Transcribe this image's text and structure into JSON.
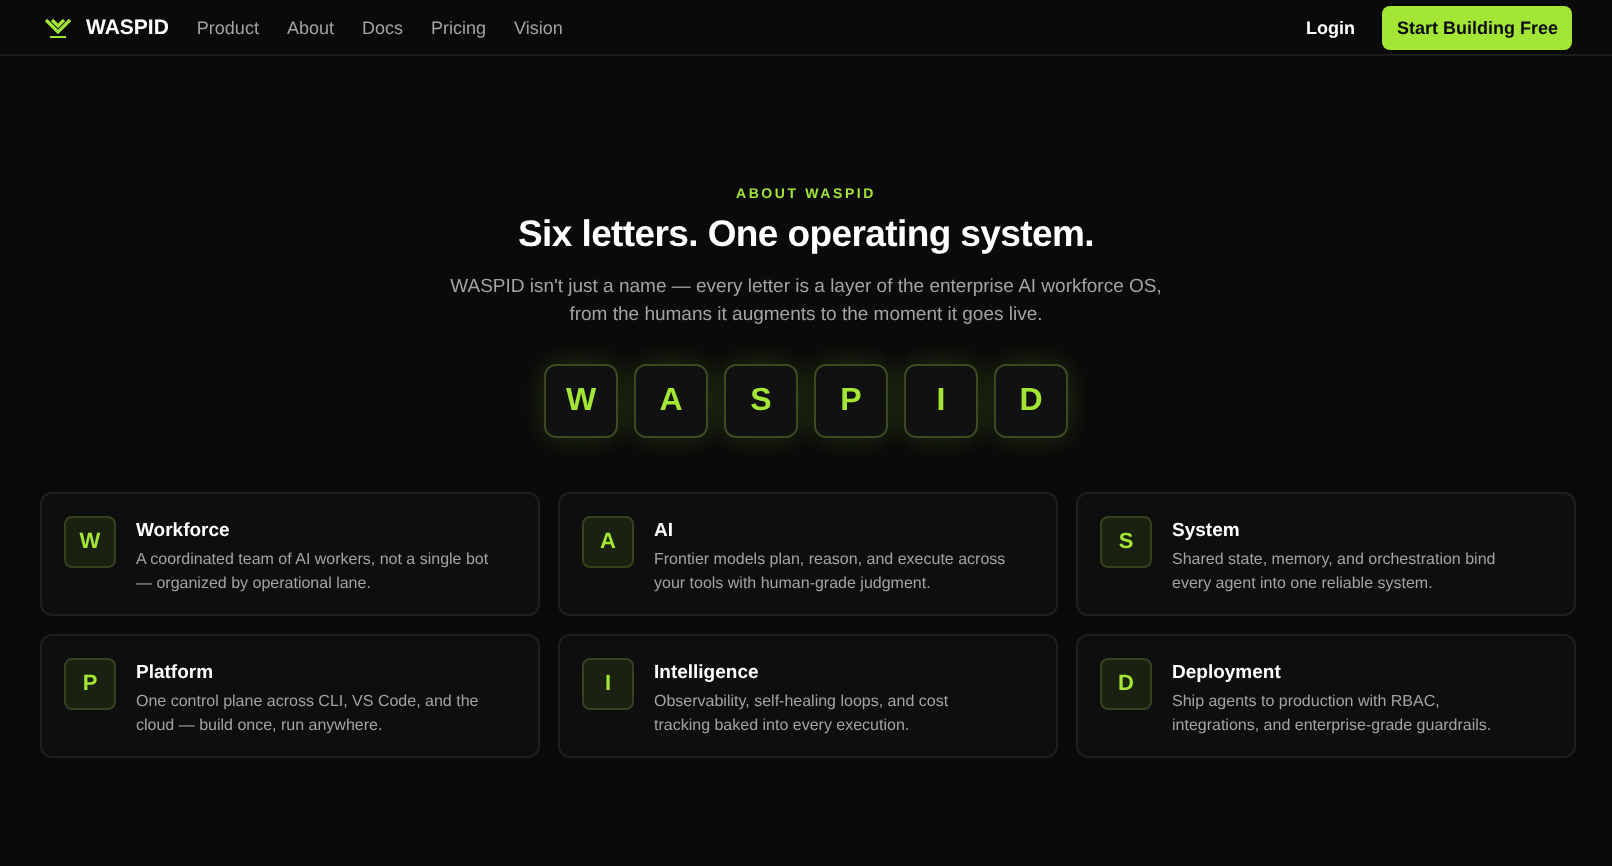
{
  "nav": {
    "brand": "WASPID",
    "links": [
      "Product",
      "About",
      "Docs",
      "Pricing",
      "Vision"
    ],
    "login": "Login",
    "cta": "Start Building Free"
  },
  "hero": {
    "eyebrow": "ABOUT WASPID",
    "title": "Six letters. One operating system.",
    "subtitle": [
      "WASPID isn't just a name — every letter is a layer of the enterprise AI workforce OS,",
      "from the humans it augments to the moment it goes live."
    ],
    "letters": [
      "W",
      "A",
      "S",
      "P",
      "I",
      "D"
    ]
  },
  "cards": [
    {
      "letter": "W",
      "title": "Workforce",
      "text": [
        "A coordinated team of AI workers, not a single bot",
        "— organized by operational lane."
      ]
    },
    {
      "letter": "A",
      "title": "AI",
      "text": [
        "Frontier models plan, reason, and execute across",
        "your tools with human-grade judgment."
      ]
    },
    {
      "letter": "S",
      "title": "System",
      "text": [
        "Shared state, memory, and orchestration bind",
        "every agent into one reliable system."
      ]
    },
    {
      "letter": "P",
      "title": "Platform",
      "text": [
        "One control plane across CLI, VS Code, and the",
        "cloud — build once, run anywhere."
      ]
    },
    {
      "letter": "I",
      "title": "Intelligence",
      "text": [
        "Observability, self-healing loops, and cost",
        "tracking baked into every execution."
      ]
    },
    {
      "letter": "D",
      "title": "Deployment",
      "text": [
        "Ship agents to production with RBAC,",
        "integrations, and enterprise-grade guardrails."
      ]
    }
  ]
}
